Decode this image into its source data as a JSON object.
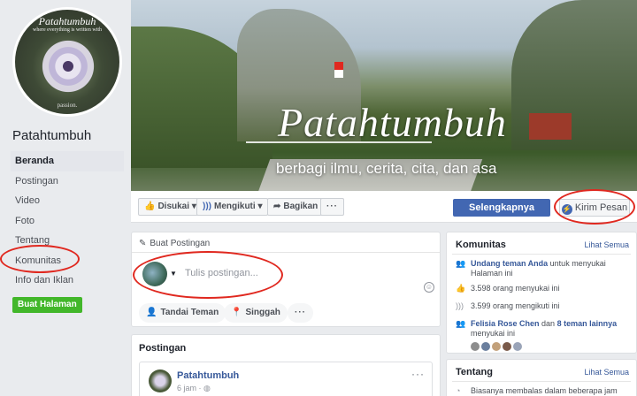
{
  "profile": {
    "pic_title": "Patahtumbuh",
    "pic_subtitle": "where everything is written with",
    "pic_bottom": "passion.",
    "page_name": "Patahtumbuh"
  },
  "sidebar": {
    "items": [
      {
        "label": "Beranda"
      },
      {
        "label": "Postingan"
      },
      {
        "label": "Video"
      },
      {
        "label": "Foto"
      },
      {
        "label": "Tentang"
      },
      {
        "label": "Komunitas"
      },
      {
        "label": "Info dan Iklan"
      }
    ],
    "create_page": "Buat Halaman"
  },
  "cover": {
    "title": "Patahtumbuh",
    "subtitle": "berbagi ilmu, cerita, cita, dan asa"
  },
  "actions": {
    "liked": "Disukai",
    "following": "Mengikuti",
    "share": "Bagikan",
    "more": "···",
    "learn_more": "Selengkapnya",
    "send_message": "Kirim Pesan"
  },
  "create_post": {
    "header": "Buat Postingan",
    "placeholder": "Tulis postingan...",
    "tag_friends": "Tandai Teman",
    "check_in": "Singgah",
    "more": "···"
  },
  "posts": {
    "header": "Postingan",
    "author": "Patahtumbuh",
    "time": "6 jam ·",
    "menu": "···"
  },
  "community": {
    "title": "Komunitas",
    "see_all": "Lihat Semua",
    "invite_link": "Undang teman Anda",
    "invite_rest": " untuk menyukai Halaman ini",
    "likes": "3.598 orang menyukai ini",
    "follows": "3.599 orang mengikuti ini",
    "friend_name": "Felisia Rose Chen",
    "friend_mid": " dan ",
    "friend_others": "8 teman lainnya",
    "friend_rest": " menyukai ini"
  },
  "about": {
    "title": "Tentang",
    "see_all": "Lihat Semua",
    "response": "Biasanya membalas dalam beberapa jam"
  },
  "colors": {
    "brand": "#4267b2",
    "link": "#365899",
    "highlight": "#e0281f",
    "green_button": "#42b72a"
  },
  "icons": [
    "thumbs-up-icon",
    "rss-icon",
    "share-icon",
    "pencil-icon",
    "tag-icon",
    "location-pin-icon",
    "messenger-icon",
    "users-icon",
    "emoji-icon",
    "clock-icon",
    "globe-icon"
  ]
}
